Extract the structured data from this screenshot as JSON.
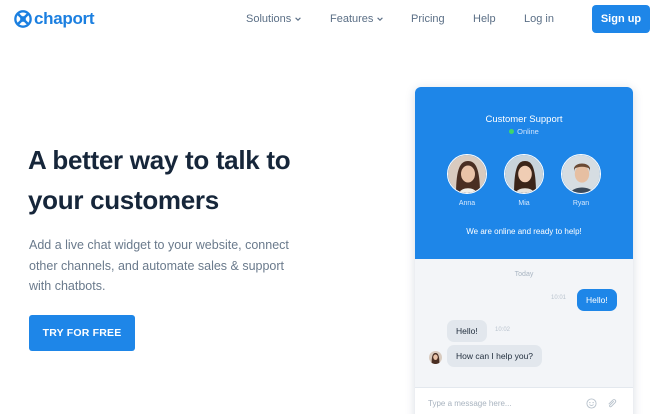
{
  "brand": {
    "name": "chaport",
    "color": "#1e86e8"
  },
  "nav": {
    "items": [
      {
        "label": "Solutions",
        "dropdown": true
      },
      {
        "label": "Features",
        "dropdown": true
      },
      {
        "label": "Pricing",
        "dropdown": false
      },
      {
        "label": "Help",
        "dropdown": false
      },
      {
        "label": "Log in",
        "dropdown": false
      }
    ],
    "signup_label": "Sign up"
  },
  "hero": {
    "title_line1": "A better way to talk to",
    "title_line2": "your customers",
    "subtitle_line1": "Add a live chat widget to your website, connect",
    "subtitle_line2": "other channels, and automate sales & support",
    "subtitle_line3": "with chatbots.",
    "cta_label": "TRY FOR FREE"
  },
  "widget": {
    "title": "Customer Support",
    "status": "Online",
    "agents": [
      {
        "name": "Anna"
      },
      {
        "name": "Mia"
      },
      {
        "name": "Ryan"
      }
    ],
    "intro": "We are online and ready to help!",
    "day_label": "Today",
    "messages": [
      {
        "from": "visitor",
        "text": "Hello!",
        "time": "10:01"
      },
      {
        "from": "agent",
        "text": "Hello!",
        "time": "10:02"
      },
      {
        "from": "agent",
        "text": "How can I help you?",
        "time": ""
      }
    ],
    "input_placeholder": "Type a message here...",
    "icons": [
      "emoji-icon",
      "attachment-icon"
    ]
  }
}
